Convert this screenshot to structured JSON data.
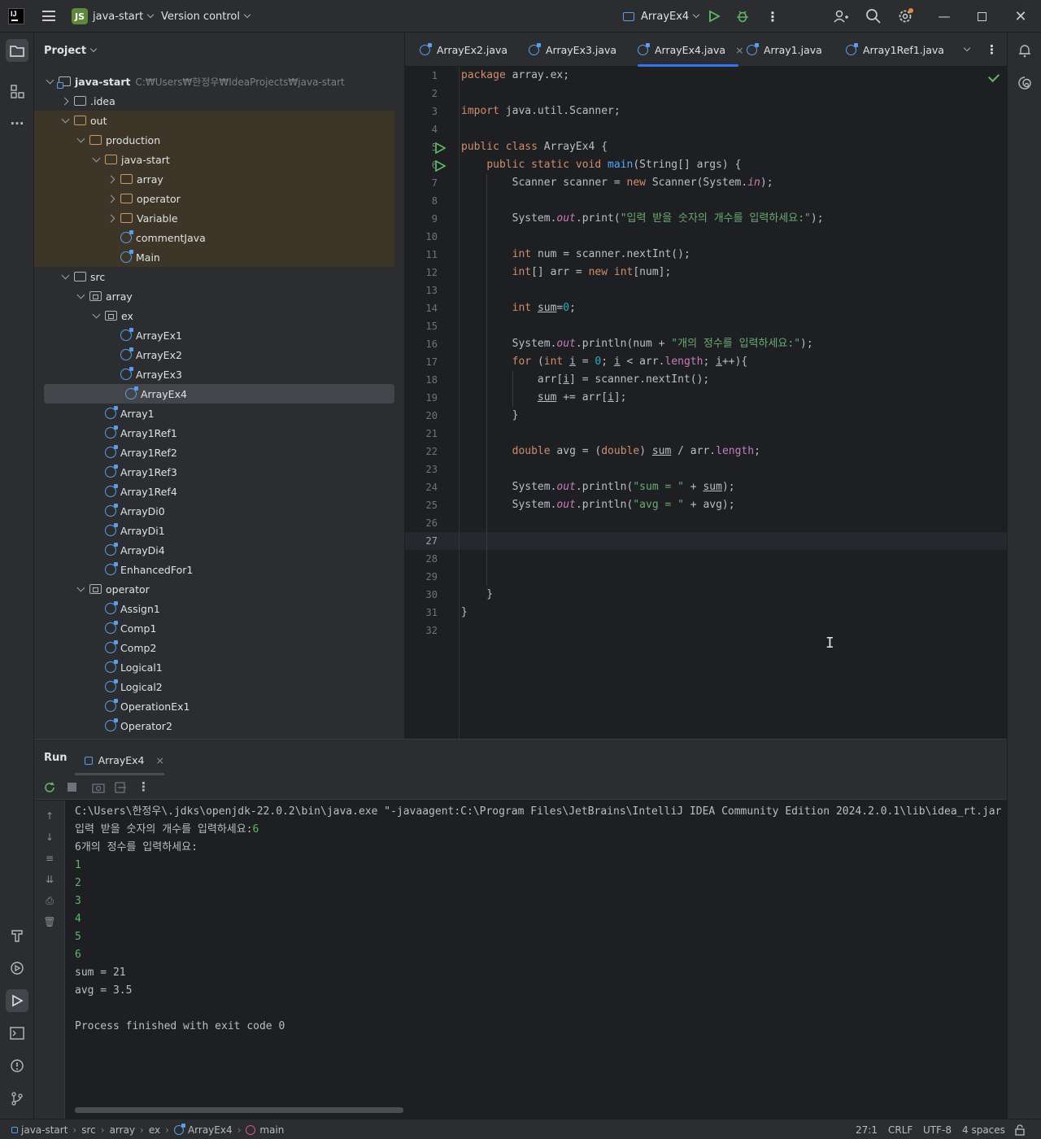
{
  "titlebar": {
    "project_badge": "JS",
    "project_name": "java-start",
    "version_control": "Version control",
    "run_config": "ArrayEx4"
  },
  "project_panel": {
    "title": "Project",
    "tree": [
      {
        "label": "java-start",
        "path": "C:₩Users₩한정우₩IdeaProjects₩java-start",
        "depth": 0,
        "arrow": "down",
        "icon": "root",
        "hl": false
      },
      {
        "label": ".idea",
        "depth": 1,
        "arrow": "right",
        "icon": "folder",
        "hl": false
      },
      {
        "label": "out",
        "depth": 1,
        "arrow": "down",
        "icon": "folder-orange",
        "hl": true
      },
      {
        "label": "production",
        "depth": 2,
        "arrow": "down",
        "icon": "folder-orange",
        "hl": true
      },
      {
        "label": "java-start",
        "depth": 3,
        "arrow": "down",
        "icon": "folder-orange",
        "hl": true
      },
      {
        "label": "array",
        "depth": 4,
        "arrow": "right",
        "icon": "folder-orange",
        "hl": true
      },
      {
        "label": "operator",
        "depth": 4,
        "arrow": "right",
        "icon": "folder-orange",
        "hl": true
      },
      {
        "label": "Variable",
        "depth": 4,
        "arrow": "right",
        "icon": "folder-orange",
        "hl": true
      },
      {
        "label": "commentJava",
        "depth": 4,
        "arrow": "none",
        "icon": "class",
        "hl": true
      },
      {
        "label": "Main",
        "depth": 4,
        "arrow": "none",
        "icon": "class",
        "hl": true
      },
      {
        "label": "src",
        "depth": 1,
        "arrow": "down",
        "icon": "folder",
        "hl": false
      },
      {
        "label": "array",
        "depth": 2,
        "arrow": "down",
        "icon": "package",
        "hl": false
      },
      {
        "label": "ex",
        "depth": 3,
        "arrow": "down",
        "icon": "package",
        "hl": false
      },
      {
        "label": "ArrayEx1",
        "depth": 4,
        "arrow": "none",
        "icon": "class",
        "hl": false
      },
      {
        "label": "ArrayEx2",
        "depth": 4,
        "arrow": "none",
        "icon": "class",
        "hl": false
      },
      {
        "label": "ArrayEx3",
        "depth": 4,
        "arrow": "none",
        "icon": "class",
        "hl": false
      },
      {
        "label": "ArrayEx4",
        "depth": 4,
        "arrow": "none",
        "icon": "class",
        "hl": false,
        "selected": true
      },
      {
        "label": "Array1",
        "depth": 3,
        "arrow": "none",
        "icon": "class",
        "hl": false
      },
      {
        "label": "Array1Ref1",
        "depth": 3,
        "arrow": "none",
        "icon": "class",
        "hl": false
      },
      {
        "label": "Array1Ref2",
        "depth": 3,
        "arrow": "none",
        "icon": "class",
        "hl": false
      },
      {
        "label": "Array1Ref3",
        "depth": 3,
        "arrow": "none",
        "icon": "class",
        "hl": false
      },
      {
        "label": "Array1Ref4",
        "depth": 3,
        "arrow": "none",
        "icon": "class",
        "hl": false
      },
      {
        "label": "ArrayDi0",
        "depth": 3,
        "arrow": "none",
        "icon": "class",
        "hl": false
      },
      {
        "label": "ArrayDi1",
        "depth": 3,
        "arrow": "none",
        "icon": "class",
        "hl": false
      },
      {
        "label": "ArrayDi4",
        "depth": 3,
        "arrow": "none",
        "icon": "class",
        "hl": false
      },
      {
        "label": "EnhancedFor1",
        "depth": 3,
        "arrow": "none",
        "icon": "class",
        "hl": false
      },
      {
        "label": "operator",
        "depth": 2,
        "arrow": "down",
        "icon": "package",
        "hl": false
      },
      {
        "label": "Assign1",
        "depth": 3,
        "arrow": "none",
        "icon": "class",
        "hl": false
      },
      {
        "label": "Comp1",
        "depth": 3,
        "arrow": "none",
        "icon": "class",
        "hl": false
      },
      {
        "label": "Comp2",
        "depth": 3,
        "arrow": "none",
        "icon": "class",
        "hl": false
      },
      {
        "label": "Logical1",
        "depth": 3,
        "arrow": "none",
        "icon": "class",
        "hl": false
      },
      {
        "label": "Logical2",
        "depth": 3,
        "arrow": "none",
        "icon": "class",
        "hl": false
      },
      {
        "label": "OperationEx1",
        "depth": 3,
        "arrow": "none",
        "icon": "class",
        "hl": false
      },
      {
        "label": "Operator2",
        "depth": 3,
        "arrow": "none",
        "icon": "class",
        "hl": false
      }
    ]
  },
  "editor": {
    "tabs": [
      {
        "label": "ArrayEx2.java",
        "active": false
      },
      {
        "label": "ArrayEx3.java",
        "active": false
      },
      {
        "label": "ArrayEx4.java",
        "active": true,
        "close": "×"
      },
      {
        "label": "Array1.java",
        "active": false
      },
      {
        "label": "Array1Ref1.java",
        "active": false
      }
    ],
    "current_line": 27,
    "run_gutter_lines": [
      5,
      6
    ],
    "lines": [
      [
        [
          "kw",
          "package "
        ],
        [
          "",
          "array.ex;"
        ]
      ],
      [],
      [
        [
          "kw",
          "import "
        ],
        [
          "",
          "java.util.Scanner;"
        ]
      ],
      [],
      [
        [
          "kw",
          "public class "
        ],
        [
          "",
          "ArrayEx4 {"
        ]
      ],
      [
        [
          "",
          "    "
        ],
        [
          "kw",
          "public static void "
        ],
        [
          "fn",
          "main"
        ],
        [
          "",
          "(String[] args) {"
        ]
      ],
      [
        [
          "",
          "        Scanner scanner = "
        ],
        [
          "kw",
          "new "
        ],
        [
          "",
          "Scanner(System."
        ],
        [
          "ital",
          "in"
        ],
        [
          "",
          ");"
        ]
      ],
      [],
      [
        [
          "",
          "        System."
        ],
        [
          "ital",
          "out"
        ],
        [
          "",
          ".print("
        ],
        [
          "str",
          "\"입력 받을 숫자의 개수를 입력하세요:\""
        ],
        [
          "",
          ");"
        ]
      ],
      [],
      [
        [
          "",
          "        "
        ],
        [
          "kw",
          "int "
        ],
        [
          "",
          "num = scanner.nextInt();"
        ]
      ],
      [
        [
          "",
          "        "
        ],
        [
          "kw",
          "int"
        ],
        [
          "",
          "[] arr = "
        ],
        [
          "kw",
          "new int"
        ],
        [
          "",
          "[num];"
        ]
      ],
      [],
      [
        [
          "",
          "        "
        ],
        [
          "kw",
          "int "
        ],
        [
          "und",
          "sum"
        ],
        [
          "",
          "="
        ],
        [
          "num",
          "0"
        ],
        [
          "",
          ";"
        ]
      ],
      [],
      [
        [
          "",
          "        System."
        ],
        [
          "ital",
          "out"
        ],
        [
          "",
          ".println(num + "
        ],
        [
          "str",
          "\"개의 정수를 입력하세요:\""
        ],
        [
          "",
          ");"
        ]
      ],
      [
        [
          "",
          "        "
        ],
        [
          "kw",
          "for "
        ],
        [
          "",
          "("
        ],
        [
          "kw",
          "int "
        ],
        [
          "und",
          "i"
        ],
        [
          "",
          " = "
        ],
        [
          "num",
          "0"
        ],
        [
          "",
          "; "
        ],
        [
          "und",
          "i"
        ],
        [
          "",
          " < arr."
        ],
        [
          "fld",
          "length"
        ],
        [
          "",
          "; "
        ],
        [
          "und",
          "i"
        ],
        [
          "",
          "++){"
        ]
      ],
      [
        [
          "",
          "            arr["
        ],
        [
          "und",
          "i"
        ],
        [
          "",
          "] = scanner.nextInt();"
        ]
      ],
      [
        [
          "",
          "            "
        ],
        [
          "und",
          "sum"
        ],
        [
          "",
          " += arr["
        ],
        [
          "und",
          "i"
        ],
        [
          "",
          "];"
        ]
      ],
      [
        [
          "",
          "        }"
        ]
      ],
      [],
      [
        [
          "",
          "        "
        ],
        [
          "kw",
          "double "
        ],
        [
          "",
          "avg = ("
        ],
        [
          "kw",
          "double"
        ],
        [
          "",
          ") "
        ],
        [
          "und",
          "sum"
        ],
        [
          "",
          " / arr."
        ],
        [
          "fld",
          "length"
        ],
        [
          "",
          ";"
        ]
      ],
      [],
      [
        [
          "",
          "        System."
        ],
        [
          "ital",
          "out"
        ],
        [
          "",
          ".println("
        ],
        [
          "str",
          "\"sum = \""
        ],
        [
          "",
          " + "
        ],
        [
          "und",
          "sum"
        ],
        [
          "",
          ");"
        ]
      ],
      [
        [
          "",
          "        System."
        ],
        [
          "ital",
          "out"
        ],
        [
          "",
          ".println("
        ],
        [
          "str",
          "\"avg = \""
        ],
        [
          "",
          " + avg);"
        ]
      ],
      [],
      [],
      [],
      [],
      [
        [
          "",
          "    }"
        ]
      ],
      [
        [
          "",
          "}"
        ]
      ],
      []
    ]
  },
  "run_panel": {
    "title": "Run",
    "tab_label": "ArrayEx4",
    "tab_close": "×",
    "console": [
      {
        "text": "C:\\Users\\한정우\\.jdks\\openjdk-22.0.2\\bin\\java.exe \"-javaagent:C:\\Program Files\\JetBrains\\IntelliJ IDEA Community Edition 2024.2.0.1\\lib\\idea_rt.jar",
        "type": "out"
      },
      {
        "text": "입력 받을 숫자의 개수를 입력하세요:",
        "input": "6",
        "type": "prompt"
      },
      {
        "text": "6개의 정수를 입력하세요:",
        "type": "out"
      },
      {
        "text": "1",
        "type": "in"
      },
      {
        "text": "2",
        "type": "in"
      },
      {
        "text": "3",
        "type": "in"
      },
      {
        "text": "4",
        "type": "in"
      },
      {
        "text": "5",
        "type": "in"
      },
      {
        "text": "6",
        "type": "in"
      },
      {
        "text": "sum = 21",
        "type": "out"
      },
      {
        "text": "avg = 3.5",
        "type": "out"
      },
      {
        "text": "",
        "type": "out"
      },
      {
        "text": "Process finished with exit code 0",
        "type": "out"
      }
    ]
  },
  "statusbar": {
    "breadcrumb": [
      "java-start",
      "src",
      "array",
      "ex",
      "ArrayEx4",
      "main"
    ],
    "position": "27:1",
    "line_ending": "CRLF",
    "encoding": "UTF-8",
    "indent": "4 spaces"
  },
  "colors": {
    "accent": "#3574f0",
    "run_green": "#5fb865",
    "keyword": "#cf8e6d",
    "string": "#6aab73",
    "method": "#56a8f5"
  }
}
